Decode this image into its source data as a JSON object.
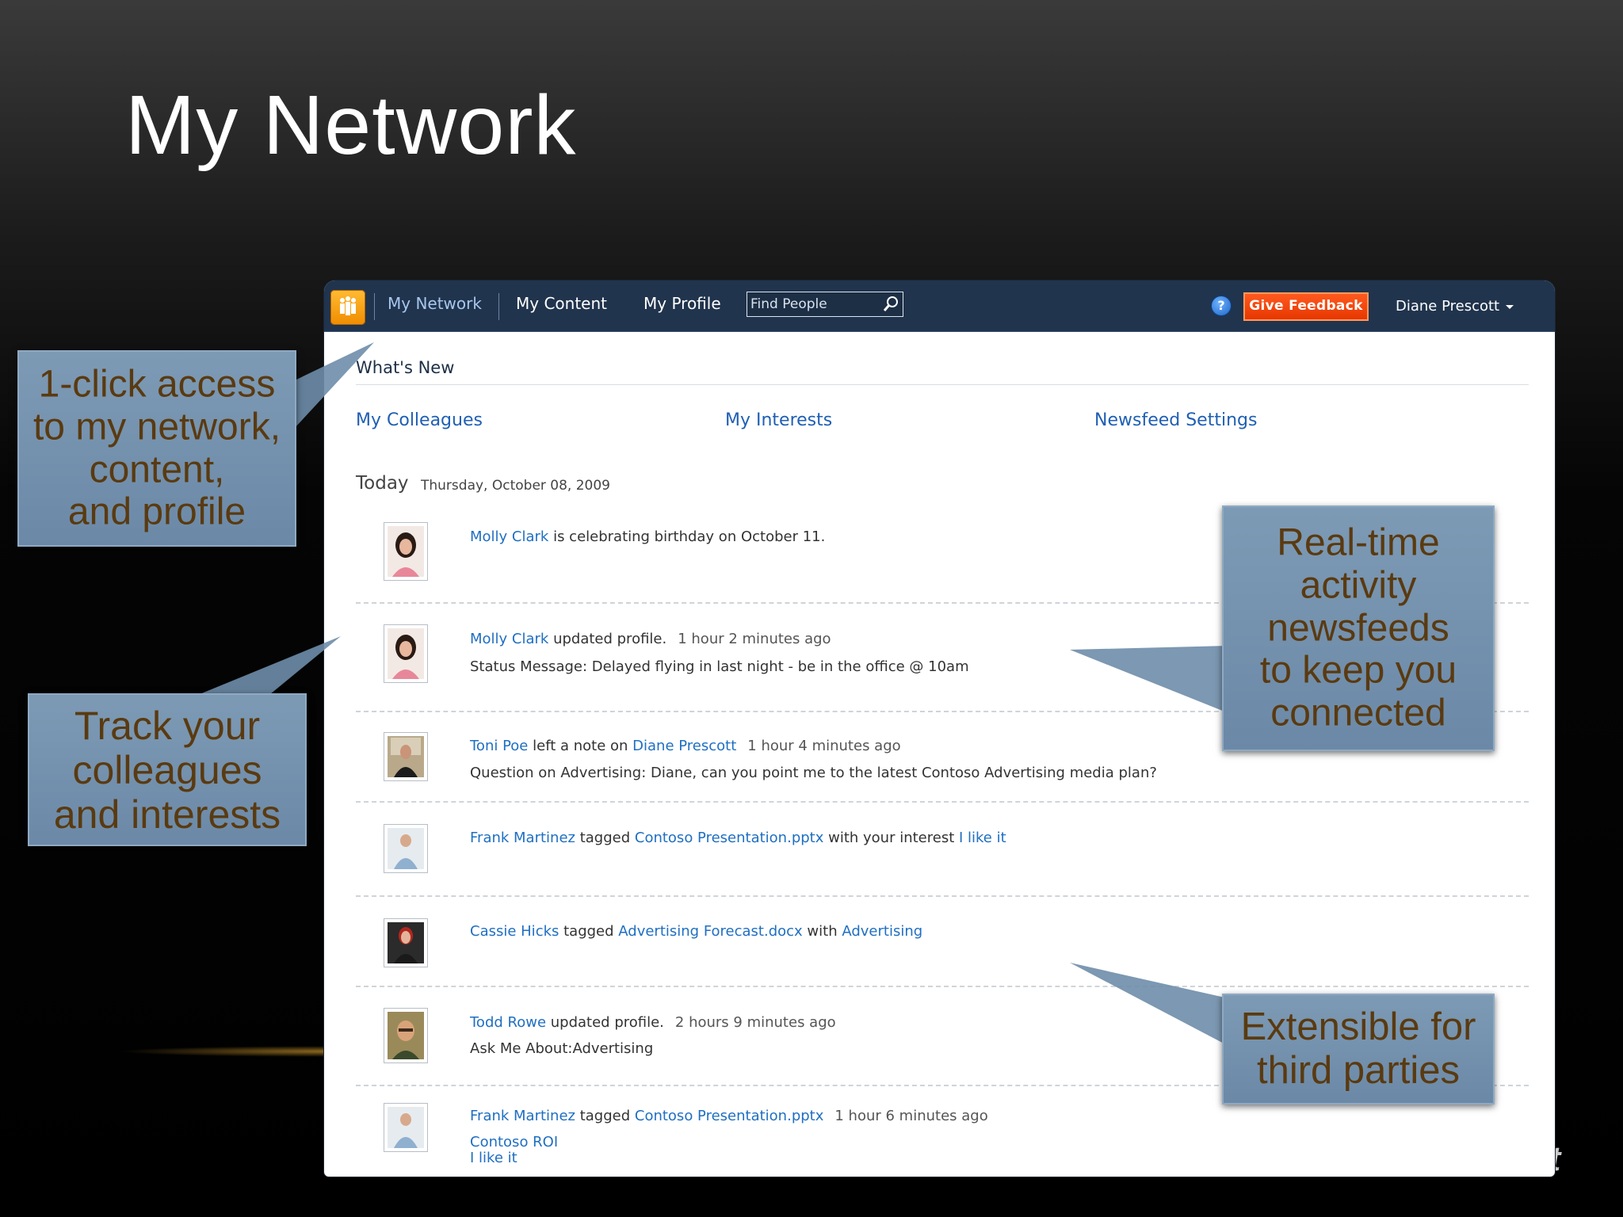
{
  "slide": {
    "title": "My Network",
    "brand_fragment": "ft"
  },
  "callouts": {
    "access": "1-click access\nto my network,\ncontent,\nand profile",
    "track": "Track your\ncolleagues\nand interests",
    "realtime": "Real-time\nactivity\nnewsfeeds\nto keep you\nconnected",
    "extensible": "Extensible for\nthird parties"
  },
  "topbar": {
    "nav": [
      "My Network",
      "My Content",
      "My Profile"
    ],
    "search_placeholder": "Find People",
    "feedback_label": "Give Feedback",
    "user_name": "Diane Prescott"
  },
  "page": {
    "section_title": "What's New",
    "subnav": [
      "My Colleagues",
      "My Interests",
      "Newsfeed Settings"
    ],
    "today_label": "Today",
    "today_date": "Thursday, October 08, 2009"
  },
  "feed": [
    {
      "person": "Molly Clark",
      "action": " is celebrating birthday on October 11."
    },
    {
      "person": "Molly Clark",
      "action": " updated profile.",
      "time": "1 hour 2 minutes ago",
      "detail": "Status Message: Delayed flying in last night - be in the office @ 10am"
    },
    {
      "person": "Toni Poe",
      "action": " left a note on ",
      "target": "Diane Prescott",
      "time": "1 hour 4 minutes ago",
      "detail": "Question on Advertising: Diane, can you point me to the latest Contoso Advertising media plan?"
    },
    {
      "person": "Frank Martinez",
      "action": " tagged ",
      "doc": "Contoso Presentation.pptx",
      "mid": " with your interest ",
      "tag": "I like it"
    },
    {
      "person": "Cassie Hicks",
      "action": " tagged ",
      "doc": "Advertising Forecast.docx",
      "mid": " with ",
      "tag": "Advertising"
    },
    {
      "person": "Todd Rowe",
      "action": " updated profile.",
      "time": "2 hours 9 minutes ago",
      "detail": "Ask Me About:Advertising"
    },
    {
      "person": "Frank Martinez",
      "action": " tagged ",
      "doc": "Contoso Presentation.pptx",
      "time": "1 hour 6 minutes ago",
      "tags": [
        "Contoso ROI",
        "I like it"
      ]
    }
  ],
  "colors": {
    "topbar": "#21344d",
    "link": "#1f6fc2",
    "feedback": "#e63700",
    "callout": "#7391ae",
    "callout_text": "#5a3a10"
  },
  "icons": [
    "app-logo-icon",
    "search-icon",
    "help-icon",
    "chevron-down-icon",
    "avatar-photo"
  ]
}
